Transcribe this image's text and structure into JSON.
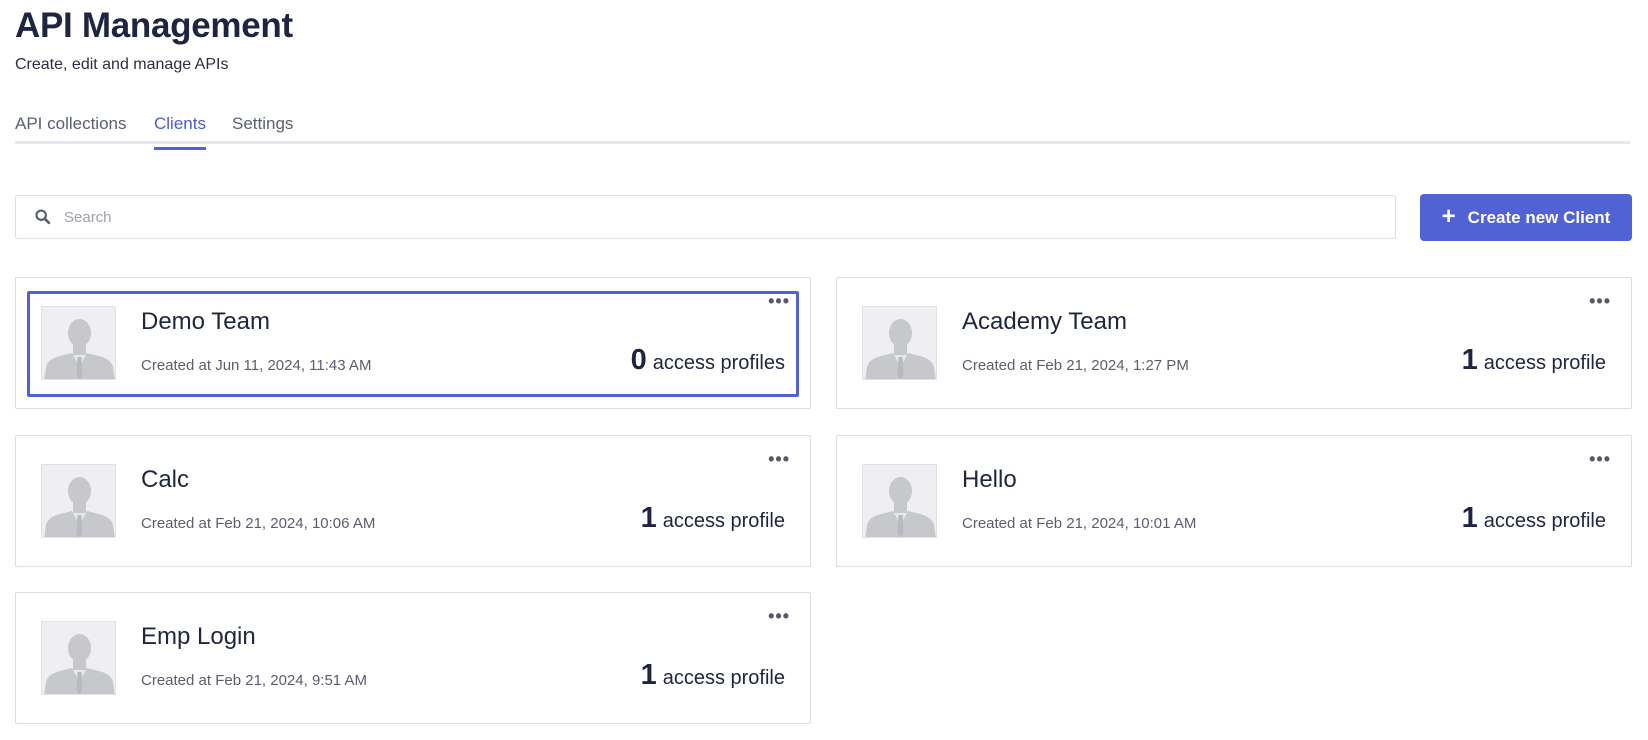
{
  "header": {
    "title": "API Management",
    "subtitle": "Create, edit and manage APIs"
  },
  "tabs": [
    {
      "label": "API collections",
      "active": false
    },
    {
      "label": "Clients",
      "active": true
    },
    {
      "label": "Settings",
      "active": false
    }
  ],
  "search": {
    "placeholder": "Search",
    "value": ""
  },
  "create_button": {
    "icon": "plus-icon",
    "label": "Create new Client"
  },
  "colors": {
    "accent": "#5062d4",
    "title": "#1f2440"
  },
  "clients": [
    {
      "name": "Demo Team",
      "created": "Created at Jun 11, 2024, 11:43 AM",
      "count": "0",
      "count_label": "access profiles",
      "selected": true
    },
    {
      "name": "Academy Team",
      "created": "Created at Feb 21, 2024, 1:27 PM",
      "count": "1",
      "count_label": "access profile",
      "selected": false
    },
    {
      "name": "Calc",
      "created": "Created at Feb 21, 2024, 10:06 AM",
      "count": "1",
      "count_label": "access profile",
      "selected": false
    },
    {
      "name": "Hello",
      "created": "Created at Feb 21, 2024, 10:01 AM",
      "count": "1",
      "count_label": "access profile",
      "selected": false
    },
    {
      "name": "Emp Login",
      "created": "Created at Feb 21, 2024, 9:51 AM",
      "count": "1",
      "count_label": "access profile",
      "selected": false
    }
  ]
}
